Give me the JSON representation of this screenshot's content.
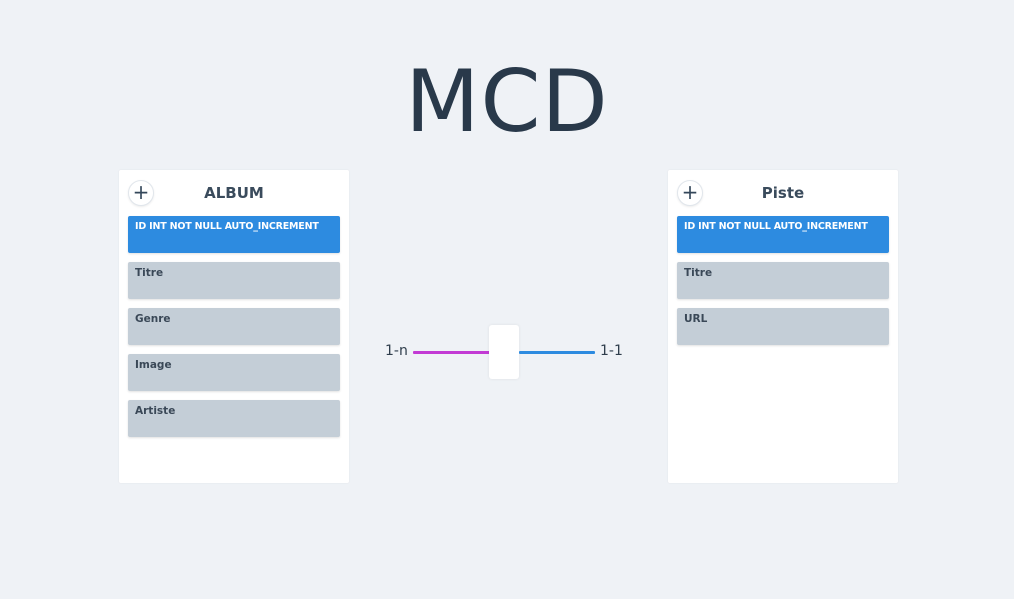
{
  "title": "MCD",
  "entities": [
    {
      "name": "ALBUM",
      "add_symbol": "+",
      "fields": [
        "ID INT NOT NULL AUTO_INCREMENT",
        "Titre",
        "Genre",
        "Image",
        "Artiste"
      ]
    },
    {
      "name": "Piste",
      "add_symbol": "+",
      "fields": [
        "ID INT NOT NULL AUTO_INCREMENT",
        "Titre",
        "URL"
      ]
    }
  ],
  "relation": {
    "left_cardinality": "1-n",
    "right_cardinality": "1-1",
    "left_color": "#c23bd4",
    "right_color": "#2d8be0"
  },
  "colors": {
    "background": "#eff2f6",
    "primary_key_field": "#2d8be0",
    "regular_field": "#c4ced7",
    "title": "#29394a"
  }
}
